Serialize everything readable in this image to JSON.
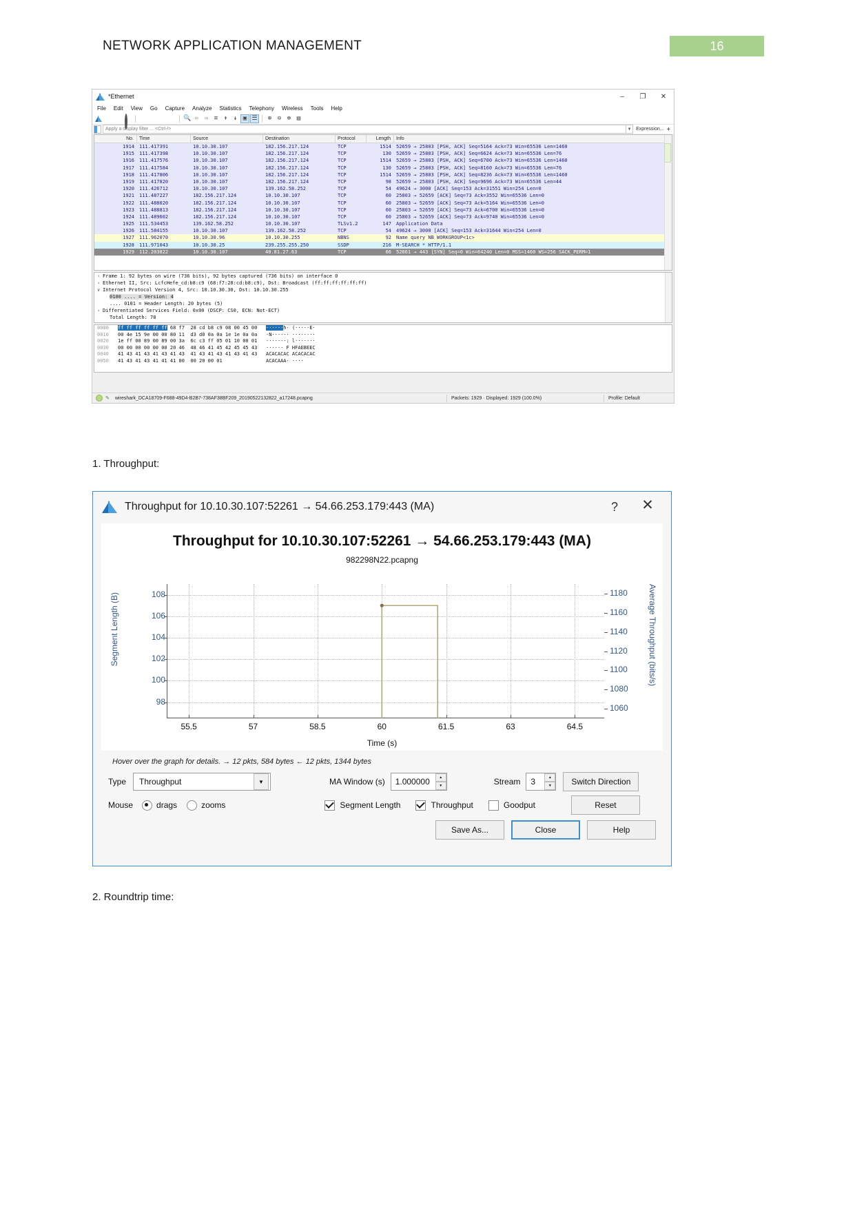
{
  "document": {
    "header_title": "NETWORK APPLICATION MANAGEMENT",
    "page_number": "16",
    "accent_green": "#a9d18e",
    "section1": "1. Throughput:",
    "section2": "2. Roundtrip time:"
  },
  "wireshark": {
    "window_title": "*Ethernet",
    "window_buttons": {
      "minimize": "–",
      "maximize": "❐",
      "close": "✕"
    },
    "menus": [
      "File",
      "Edit",
      "View",
      "Go",
      "Capture",
      "Analyze",
      "Statistics",
      "Telephony",
      "Wireless",
      "Tools",
      "Help"
    ],
    "filter": {
      "placeholder": "Apply a display filter ... <Ctrl-/>",
      "value": "",
      "expression_label": "Expression...",
      "plus_label": "+"
    },
    "columns": [
      "No.",
      "Time",
      "Source",
      "Destination",
      "Protocol",
      "Length",
      "Info"
    ],
    "packets": [
      {
        "no": "1914",
        "time": "111.417391",
        "src": "10.10.30.107",
        "dst": "182.156.217.124",
        "proto": "TCP",
        "len": "1514",
        "info": "52659 → 25803 [PSH, ACK] Seq=5164 Ack=73 Win=65536 Len=1460",
        "style": "bg-tcp"
      },
      {
        "no": "1915",
        "time": "111.417398",
        "src": "10.10.30.107",
        "dst": "182.156.217.124",
        "proto": "TCP",
        "len": "130",
        "info": "52659 → 25803 [PSH, ACK] Seq=6624 Ack=73 Win=65536 Len=76",
        "style": "bg-tcp"
      },
      {
        "no": "1916",
        "time": "111.417576",
        "src": "10.10.30.107",
        "dst": "182.156.217.124",
        "proto": "TCP",
        "len": "1514",
        "info": "52659 → 25803 [PSH, ACK] Seq=6700 Ack=73 Win=65536 Len=1460",
        "style": "bg-tcp"
      },
      {
        "no": "1917",
        "time": "111.417584",
        "src": "10.10.30.107",
        "dst": "182.156.217.124",
        "proto": "TCP",
        "len": "130",
        "info": "52659 → 25803 [PSH, ACK] Seq=8160 Ack=73 Win=65536 Len=76",
        "style": "bg-tcp"
      },
      {
        "no": "1918",
        "time": "111.417806",
        "src": "10.10.30.107",
        "dst": "182.156.217.124",
        "proto": "TCP",
        "len": "1514",
        "info": "52659 → 25803 [PSH, ACK] Seq=8236 Ack=73 Win=65536 Len=1460",
        "style": "bg-tcp"
      },
      {
        "no": "1919",
        "time": "111.417820",
        "src": "10.10.30.107",
        "dst": "182.156.217.124",
        "proto": "TCP",
        "len": "98",
        "info": "52659 → 25803 [PSH, ACK] Seq=9696 Ack=73 Win=65536 Len=44",
        "style": "bg-tcp"
      },
      {
        "no": "1920",
        "time": "111.426712",
        "src": "10.10.30.107",
        "dst": "139.162.58.252",
        "proto": "TCP",
        "len": "54",
        "info": "49624 → 3000 [ACK] Seq=153 Ack=31551 Win=254 Len=0",
        "style": "bg-tcp"
      },
      {
        "no": "1921",
        "time": "111.487227",
        "src": "182.156.217.124",
        "dst": "10.10.30.107",
        "proto": "TCP",
        "len": "60",
        "info": "25803 → 52659 [ACK] Seq=73 Ack=3552 Win=65536 Len=0",
        "style": "bg-tcp"
      },
      {
        "no": "1922",
        "time": "111.488020",
        "src": "182.156.217.124",
        "dst": "10.10.30.107",
        "proto": "TCP",
        "len": "60",
        "info": "25803 → 52659 [ACK] Seq=73 Ack=5164 Win=65536 Len=0",
        "style": "bg-tcp"
      },
      {
        "no": "1923",
        "time": "111.488813",
        "src": "182.156.217.124",
        "dst": "10.10.30.107",
        "proto": "TCP",
        "len": "60",
        "info": "25803 → 52659 [ACK] Seq=73 Ack=6700 Win=65536 Len=0",
        "style": "bg-tcp"
      },
      {
        "no": "1924",
        "time": "111.489602",
        "src": "182.156.217.124",
        "dst": "10.10.30.107",
        "proto": "TCP",
        "len": "60",
        "info": "25803 → 52659 [ACK] Seq=73 Ack=9740 Win=65536 Len=0",
        "style": "bg-tcp"
      },
      {
        "no": "1925",
        "time": "111.534453",
        "src": "139.162.58.252",
        "dst": "10.10.30.107",
        "proto": "TLSv1.2",
        "len": "147",
        "info": "Application Data",
        "style": "bg-tcp"
      },
      {
        "no": "1926",
        "time": "111.584155",
        "src": "10.10.30.107",
        "dst": "139.162.58.252",
        "proto": "TCP",
        "len": "54",
        "info": "49624 → 3000 [ACK] Seq=153 Ack=31644 Win=254 Len=0",
        "style": "bg-tcp"
      },
      {
        "no": "1927",
        "time": "111.962070",
        "src": "10.10.30.96",
        "dst": "10.10.30.255",
        "proto": "NBNS",
        "len": "92",
        "info": "Name query NB WORKGROUP<1c>",
        "style": "bg-yellow"
      },
      {
        "no": "1928",
        "time": "111.971043",
        "src": "10.10.30.25",
        "dst": "239.255.255.250",
        "proto": "SSDP",
        "len": "216",
        "info": "M-SEARCH * HTTP/1.1",
        "style": "bg-cyan"
      },
      {
        "no": "1929",
        "time": "112.203822",
        "src": "10.10.30.107",
        "dst": "40.81.27.63",
        "proto": "TCP",
        "len": "66",
        "info": "52661 → 443 [SYN] Seq=0 Win=64240 Len=0 MSS=1460 WS=256 SACK_PERM=1",
        "style": "bg-sel"
      }
    ],
    "detail_lines": [
      {
        "tw": "›",
        "text": "Frame 1: 92 bytes on wire (736 bits), 92 bytes captured (736 bits) on interface 0",
        "indent": false,
        "hl": false
      },
      {
        "tw": "›",
        "text": "Ethernet II, Src: LcfcHefe_cd:b8:c9 (68:f7:28:cd:b8:c9), Dst: Broadcast (ff:ff:ff:ff:ff:ff)",
        "indent": false,
        "hl": false
      },
      {
        "tw": "∨",
        "text": "Internet Protocol Version 4, Src: 10.10.30.30, Dst: 10.10.30.255",
        "indent": false,
        "hl": false
      },
      {
        "tw": "",
        "text": "0100 .... = Version: 4",
        "indent": true,
        "hl": true
      },
      {
        "tw": "",
        "text": ".... 0101 = Header Length: 20 bytes (5)",
        "indent": true,
        "hl": false
      },
      {
        "tw": "›",
        "text": "Differentiated Services Field: 0x00 (DSCP: CS0, ECN: Not-ECT)",
        "indent": false,
        "hl": false
      },
      {
        "tw": "",
        "text": "Total Length: 78",
        "indent": true,
        "hl": false
      }
    ],
    "hex_rows": [
      {
        "off": "0000",
        "sel": "ff ff ff ff ff ff",
        "rest": " 68 f7  28 cd b8 c9 08 00 45 00",
        "ascii_sel": "······",
        "ascii": "h· (·····E·"
      },
      {
        "off": "0010",
        "sel": "",
        "rest": "00 4e 15 9e 00 00 80 11  d3 d0 0a 0a 1e 1e 0a 0a",
        "ascii_sel": "",
        "ascii": "·N······ ········"
      },
      {
        "off": "0020",
        "sel": "",
        "rest": "1e ff 00 89 00 89 00 3a  6c c3 ff 05 01 10 00 01",
        "ascii_sel": "",
        "ascii": "·······: l·······"
      },
      {
        "off": "0030",
        "sel": "",
        "rest": "00 00 00 00 00 00 20 46  48 46 41 45 42 45 45 43",
        "ascii_sel": "",
        "ascii": "······ F HFAEBEEC"
      },
      {
        "off": "0040",
        "sel": "",
        "rest": "41 43 41 43 41 43 41 43  41 43 41 43 41 43 41 43",
        "ascii_sel": "",
        "ascii": "ACACACAC ACACACAC"
      },
      {
        "off": "0050",
        "sel": "",
        "rest": "41 43 41 43 41 41 41 00  00 20 00 01",
        "ascii_sel": "",
        "ascii": "ACACAAA· ····"
      }
    ],
    "status": {
      "file": "wireshark_DCA18709-F688-49D4-B2B7-738AF38BF209_20190522132822_a17248.pcapng",
      "packets": "Packets: 1929 · Displayed: 1929 (100.0%)",
      "profile": "Profile: Default"
    }
  },
  "throughput_dialog": {
    "title": "Throughput for 10.10.30.107:52261 → 54.66.253.179:443 (MA)",
    "help_icon": "?",
    "close_icon": "✕",
    "plot_title": "Throughput for 10.10.30.107:52261 → 54.66.253.179:443 (MA)",
    "plot_subtitle": "982298N22.pcapng",
    "hint": "Hover over the graph for details. → 12 pkts, 584 bytes ← 12 pkts, 1344 bytes",
    "type_label": "Type",
    "type_value": "Throughput",
    "ma_window_label": "MA Window (s)",
    "ma_window_value": "1.000000",
    "stream_label": "Stream",
    "stream_value": "3",
    "switch_direction_label": "Switch Direction",
    "mouse_label": "Mouse",
    "mouse_drags_label": "drags",
    "mouse_zooms_label": "zooms",
    "mouse_selected": "drags",
    "checkbox_segment_length": {
      "label": "Segment Length",
      "checked": true
    },
    "checkbox_throughput": {
      "label": "Throughput",
      "checked": true
    },
    "checkbox_goodput": {
      "label": "Goodput",
      "checked": false
    },
    "reset_label": "Reset",
    "save_as_label": "Save As...",
    "close_label": "Close",
    "help_label": "Help"
  },
  "chart_data": {
    "type": "line",
    "title": "Throughput for 10.10.30.107:52261 → 54.66.253.179:443 (MA)",
    "subtitle": "982298N22.pcapng",
    "xlabel": "Time (s)",
    "ylabel": "Segment Length (B)",
    "y2label": "Average Throughput (bits/s)",
    "xlim": [
      55.0,
      65.2
    ],
    "xticks": [
      55.5,
      57,
      58.5,
      60,
      61.5,
      63,
      64.5
    ],
    "ylim": [
      96.5,
      109
    ],
    "yticks": [
      98,
      100,
      102,
      104,
      106,
      108
    ],
    "y2lim": [
      1050,
      1190
    ],
    "y2ticks": [
      1060,
      1080,
      1100,
      1120,
      1140,
      1160,
      1180
    ],
    "grid": true,
    "legend": "none",
    "series": [
      {
        "name": "Segment Length",
        "color": "#a9a06a",
        "x": [
          60.0,
          60.0,
          61.3,
          61.3
        ],
        "y": [
          96.5,
          107.0,
          107.0,
          96.5
        ]
      }
    ],
    "markers": [
      {
        "x": 60.0,
        "y": 107.0,
        "color": "#7a7450"
      }
    ]
  }
}
